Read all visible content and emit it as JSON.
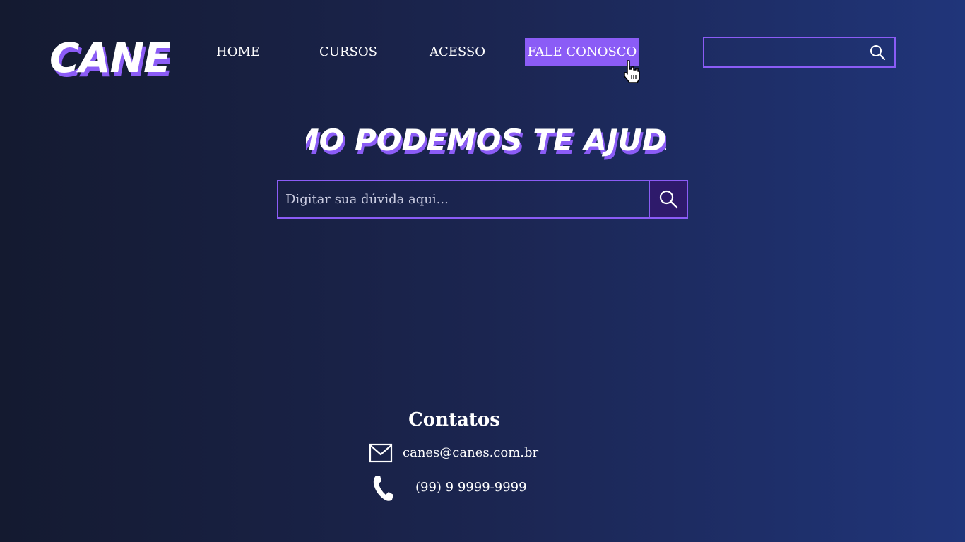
{
  "brand": {
    "logo_text": "CANES",
    "accent_color": "#8b5cf6"
  },
  "nav": {
    "items": [
      {
        "label": "HOME"
      },
      {
        "label": "CURSOS"
      },
      {
        "label": "ACESSO"
      },
      {
        "label": "FALE CONOSCO",
        "active": true
      }
    ]
  },
  "header_search": {
    "value": "",
    "icon": "search-icon"
  },
  "hero": {
    "title": "COMO PODEMOS TE AJUDAR?",
    "search_placeholder": "Digitar sua dúvida aqui...",
    "search_icon": "search-icon"
  },
  "contacts": {
    "title": "Contatos",
    "email": {
      "icon": "mail-icon",
      "text": "canes@canes.com.br"
    },
    "phone": {
      "icon": "phone-icon",
      "text": "(99) 9 9999-9999"
    }
  }
}
